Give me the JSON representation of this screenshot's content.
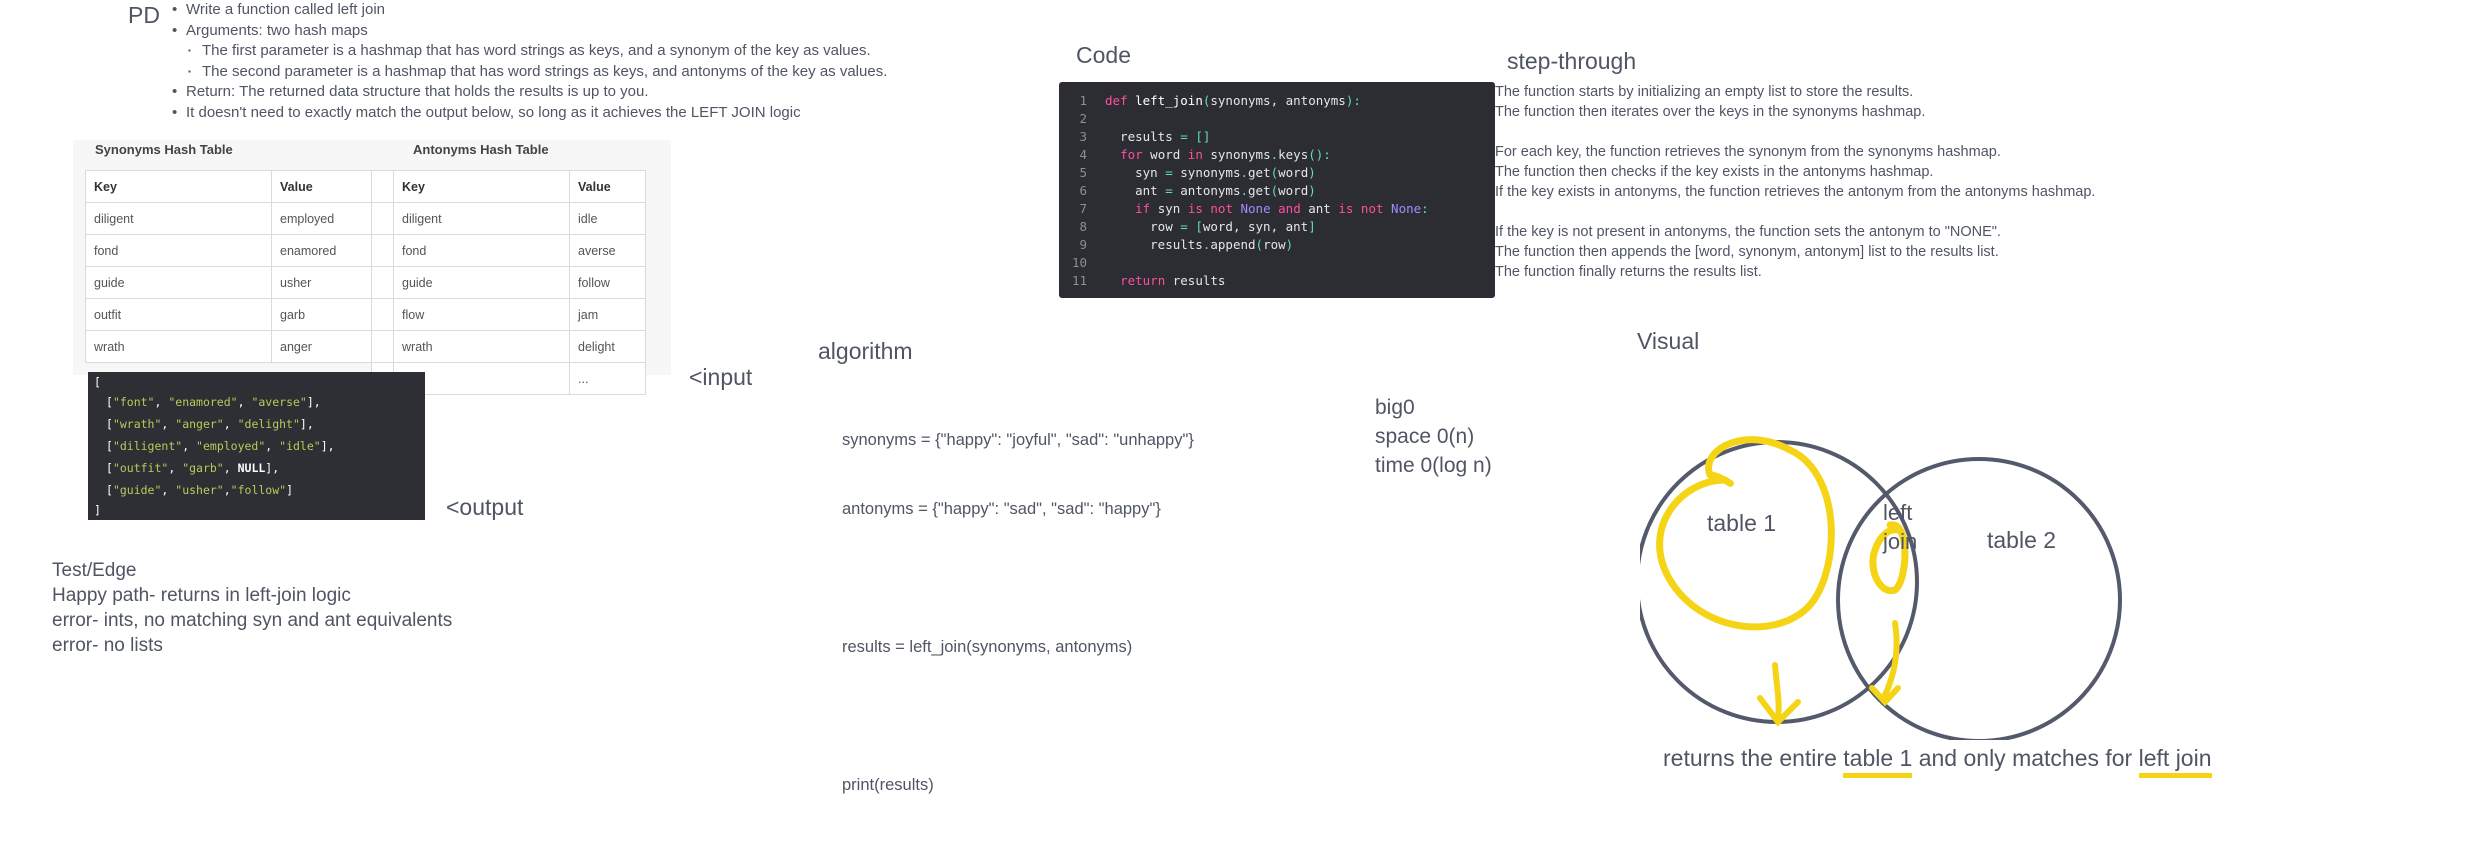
{
  "pd": {
    "label": "PD",
    "items": [
      {
        "text": "Write a function called left join",
        "sub": false
      },
      {
        "text": "Arguments: two hash maps",
        "sub": false
      },
      {
        "text": "The first parameter is a hashmap that has word strings as keys, and a synonym of the key as values.",
        "sub": true
      },
      {
        "text": "The second parameter is a hashmap that has word strings as keys, and antonyms of the key as values.",
        "sub": true
      },
      {
        "text": "Return: The returned data structure that holds the results is up to you.",
        "sub": false
      },
      {
        "text": "It doesn't need to exactly match the output below, so long as it achieves the LEFT JOIN logic",
        "sub": false
      }
    ]
  },
  "synonyms_table": {
    "title": "Synonyms Hash Table",
    "headers": [
      "Key",
      "Value"
    ],
    "rows": [
      [
        "diligent",
        "employed"
      ],
      [
        "fond",
        "enamored"
      ],
      [
        "guide",
        "usher"
      ],
      [
        "outfit",
        "garb"
      ],
      [
        "wrath",
        "anger"
      ]
    ]
  },
  "antonyms_table": {
    "title": "Antonyms Hash Table",
    "headers": [
      "Key",
      "Value"
    ],
    "rows": [
      [
        "diligent",
        "idle"
      ],
      [
        "fond",
        "averse"
      ],
      [
        "guide",
        "follow"
      ],
      [
        "flow",
        "jam"
      ],
      [
        "wrath",
        "delight"
      ],
      [
        "...",
        "..."
      ]
    ]
  },
  "output_block": {
    "open": "[",
    "rows": [
      [
        "\"font\"",
        "\"enamored\"",
        "\"averse\""
      ],
      [
        "\"wrath\"",
        "\"anger\"",
        "\"delight\""
      ],
      [
        "\"diligent\"",
        "\"employed\"",
        "\"idle\""
      ],
      [
        "\"outfit\"",
        "\"garb\"",
        "NULL"
      ],
      [
        "\"guide\"",
        "\"usher\"",
        "\"follow\""
      ]
    ],
    "close": "]"
  },
  "notes": {
    "input": "<input",
    "output": "<output"
  },
  "test_edge": {
    "title": "Test/Edge",
    "lines": [
      "Happy path- returns in left-join logic",
      "error- ints, no matching syn and ant equivalents",
      "error- no lists"
    ]
  },
  "algorithm": {
    "title": "algorithm",
    "lines": [
      "synonyms = {\"happy\": \"joyful\", \"sad\": \"unhappy\"}",
      "antonyms = {\"happy\": \"sad\", \"sad\": \"happy\"}",
      "",
      "results = left_join(synonyms, antonyms)",
      "",
      "print(results)"
    ]
  },
  "code": {
    "title": "Code",
    "line_numbers": [
      "1",
      "2",
      "3",
      "4",
      "5",
      "6",
      "7",
      "8",
      "9",
      "10",
      "11"
    ]
  },
  "step_through": {
    "title": "step-through",
    "lines": [
      "The function starts by initializing an empty list to store the results.",
      "The function then iterates over the keys in the synonyms hashmap.",
      "",
      "For each key, the function retrieves the synonym from the synonyms hashmap.",
      "The function then checks if the key exists in the antonyms hashmap.",
      "If the key exists in antonyms, the function retrieves the antonym from the antonyms hashmap.",
      "",
      "If the key is not present in antonyms, the function sets the antonym to \"NONE\".",
      "The function then appends the [word, synonym, antonym] list to the results list.",
      "The function finally returns the results list."
    ]
  },
  "big_o": {
    "title": "big0",
    "space": "space 0(n)",
    "time": "time 0(log n)"
  },
  "visual": {
    "title": "Visual",
    "left_label": "table 1",
    "middle_label_1": "left",
    "middle_label_2": "join",
    "right_label": "table 2",
    "caption_pre": "returns the entire ",
    "caption_table": "table 1",
    "caption_mid": " and only matches for ",
    "caption_join": "left join",
    "highlight_color": "#f5d415",
    "circle_color": "#545a6b"
  }
}
